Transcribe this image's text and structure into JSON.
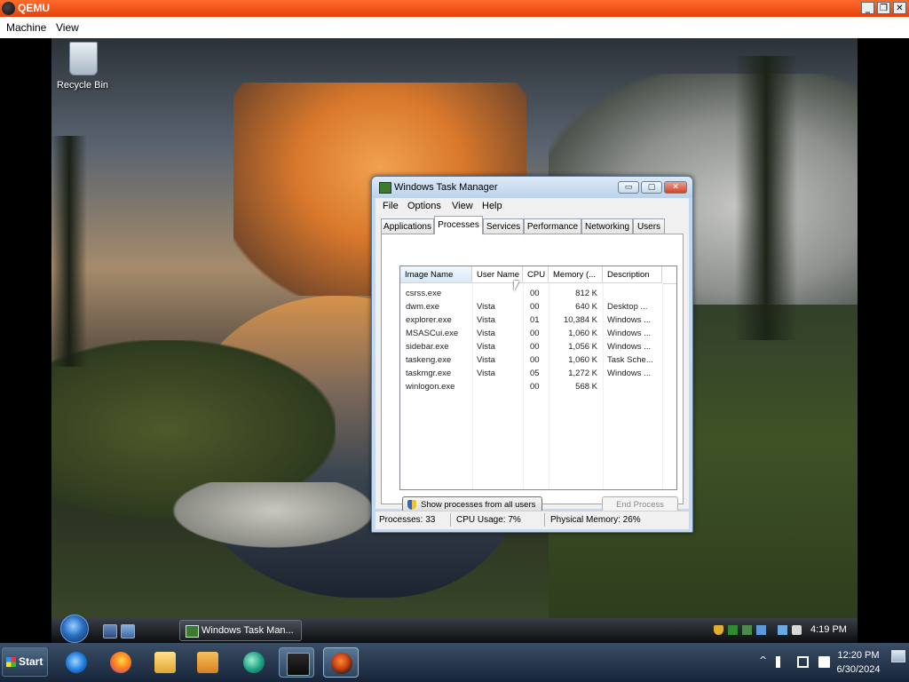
{
  "host": {
    "title": "QEMU",
    "menu": [
      "Machine",
      "View"
    ],
    "controls": [
      "_",
      "❐",
      "✕"
    ]
  },
  "desktop": {
    "icons": [
      {
        "label": "Recycle Bin",
        "icon": "recycle-bin-icon"
      }
    ]
  },
  "task_manager": {
    "title": "Windows Task Manager",
    "menu": [
      "File",
      "Options",
      "View",
      "Help"
    ],
    "tabs": [
      "Applications",
      "Processes",
      "Services",
      "Performance",
      "Networking",
      "Users"
    ],
    "active_tab": "Processes",
    "columns": [
      "Image Name",
      "User Name",
      "CPU",
      "Memory (...",
      "Description"
    ],
    "rows": [
      {
        "image": "csrss.exe",
        "user": "",
        "cpu": "00",
        "mem": "812 K",
        "desc": ""
      },
      {
        "image": "dwm.exe",
        "user": "Vista",
        "cpu": "00",
        "mem": "640 K",
        "desc": "Desktop ..."
      },
      {
        "image": "explorer.exe",
        "user": "Vista",
        "cpu": "01",
        "mem": "10,384 K",
        "desc": "Windows ..."
      },
      {
        "image": "MSASCui.exe",
        "user": "Vista",
        "cpu": "00",
        "mem": "1,060 K",
        "desc": "Windows ..."
      },
      {
        "image": "sidebar.exe",
        "user": "Vista",
        "cpu": "00",
        "mem": "1,056 K",
        "desc": "Windows ..."
      },
      {
        "image": "taskeng.exe",
        "user": "Vista",
        "cpu": "00",
        "mem": "1,060 K",
        "desc": "Task Sche..."
      },
      {
        "image": "taskmgr.exe",
        "user": "Vista",
        "cpu": "05",
        "mem": "1,272 K",
        "desc": "Windows ..."
      },
      {
        "image": "winlogon.exe",
        "user": "",
        "cpu": "00",
        "mem": "568 K",
        "desc": ""
      }
    ],
    "show_all_button": "Show processes from all users",
    "end_process_button": "End Process",
    "status": {
      "processes": "Processes: 33",
      "cpu": "CPU Usage: 7%",
      "memory": "Physical Memory: 26%"
    },
    "window_controls": [
      "▭",
      "▢",
      "✕"
    ]
  },
  "vista_taskbar": {
    "task_button": "Windows Task Man...",
    "clock": "4:19 PM"
  },
  "host_taskbar": {
    "start_label": "Start",
    "pinned": [
      "internet-explorer-icon",
      "firefox-icon",
      "file-explorer-icon",
      "media-player-icon",
      "browser-icon",
      "terminal-icon",
      "qemu-icon"
    ],
    "tray_overflow": "^",
    "time": "12:20 PM",
    "date": "6/30/2024"
  },
  "colors": {
    "qemu_titlebar": "#e8410c",
    "vista_window_frame": "#c5d8ec",
    "host_taskbar": "#17253a"
  }
}
